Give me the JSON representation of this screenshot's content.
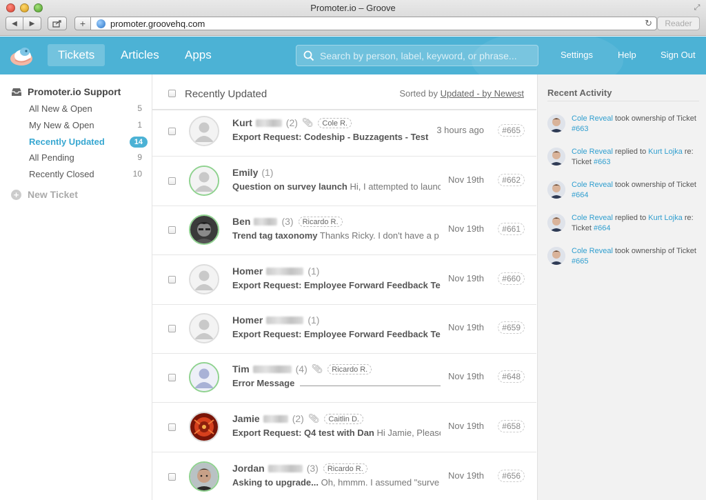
{
  "browser": {
    "window_title": "Promoter.io – Groove",
    "url": "promoter.groovehq.com",
    "reader_label": "Reader"
  },
  "header": {
    "nav": [
      "Tickets",
      "Articles",
      "Apps"
    ],
    "search_placeholder": "Search by person, label, keyword, or phrase...",
    "links": [
      "Settings",
      "Help",
      "Sign Out"
    ],
    "accent_color": "#4cb2d5"
  },
  "sidebar": {
    "mailbox_name": "Promoter.io Support",
    "folders": [
      {
        "label": "All New & Open",
        "count": "5"
      },
      {
        "label": "My New & Open",
        "count": "1"
      },
      {
        "label": "Recently Updated",
        "count": "14"
      },
      {
        "label": "All Pending",
        "count": "9"
      },
      {
        "label": "Recently Closed",
        "count": "10"
      }
    ],
    "new_ticket_label": "New Ticket"
  },
  "list": {
    "title": "Recently Updated",
    "sort_prefix": "Sorted by",
    "sort_value": "Updated - by Newest",
    "tickets": [
      {
        "first": "Kurt",
        "count": "(2)",
        "assignee": "Cole R.",
        "subject": "Export Request: Codeship - Buzzagents - Test",
        "preview": "",
        "date": "3 hours ago",
        "id": "#665"
      },
      {
        "first": "Emily",
        "count": "(1)",
        "assignee": "",
        "subject": "Question on survey launch",
        "preview": "Hi, I attempted to launch",
        "date": "Nov 19th",
        "id": "#662"
      },
      {
        "first": "Ben",
        "count": "(3)",
        "assignee": "Ricardo R.",
        "subject": "Trend tag taxonomy",
        "preview": "Thanks Ricky. I don't have a p",
        "date": "Nov 19th",
        "id": "#661"
      },
      {
        "first": "Homer",
        "count": "(1)",
        "assignee": "",
        "subject": "Export Request: Employee Forward Feedback Te",
        "preview": "",
        "date": "Nov 19th",
        "id": "#660"
      },
      {
        "first": "Homer",
        "count": "(1)",
        "assignee": "",
        "subject": "Export Request: Employee Forward Feedback Te",
        "preview": "",
        "date": "Nov 19th",
        "id": "#659"
      },
      {
        "first": "Tim",
        "count": "(4)",
        "assignee": "Ricardo R.",
        "subject": "Error Message",
        "preview": "",
        "date": "Nov 19th",
        "id": "#648"
      },
      {
        "first": "Jamie",
        "count": "(2)",
        "assignee": "Caitlin D.",
        "subject": "Export Request: Q4 test with Dan",
        "preview": "Hi Jamie, Please",
        "date": "Nov 19th",
        "id": "#658"
      },
      {
        "first": "Jordan",
        "count": "(3)",
        "assignee": "Ricardo R.",
        "subject": "Asking to upgrade...",
        "preview": "Oh, hmmm. I assumed \"surve",
        "date": "Nov 19th",
        "id": "#656"
      }
    ]
  },
  "activity": {
    "title": "Recent Activity",
    "items": [
      {
        "actor": "Cole Reveal",
        "action": " took ownership of Ticket ",
        "target": "",
        "ticket_prefix": "",
        "ticket": "#663"
      },
      {
        "actor": "Cole Reveal",
        "action": " replied to ",
        "target": "Kurt Lojka",
        "ticket_prefix": " re: Ticket ",
        "ticket": "#663"
      },
      {
        "actor": "Cole Reveal",
        "action": " took ownership of Ticket ",
        "target": "",
        "ticket_prefix": "",
        "ticket": "#664"
      },
      {
        "actor": "Cole Reveal",
        "action": " replied to ",
        "target": "Kurt Lojka",
        "ticket_prefix": " re: Ticket ",
        "ticket": "#664"
      },
      {
        "actor": "Cole Reveal",
        "action": " took ownership of Ticket ",
        "target": "",
        "ticket_prefix": "",
        "ticket": "#665"
      }
    ]
  }
}
